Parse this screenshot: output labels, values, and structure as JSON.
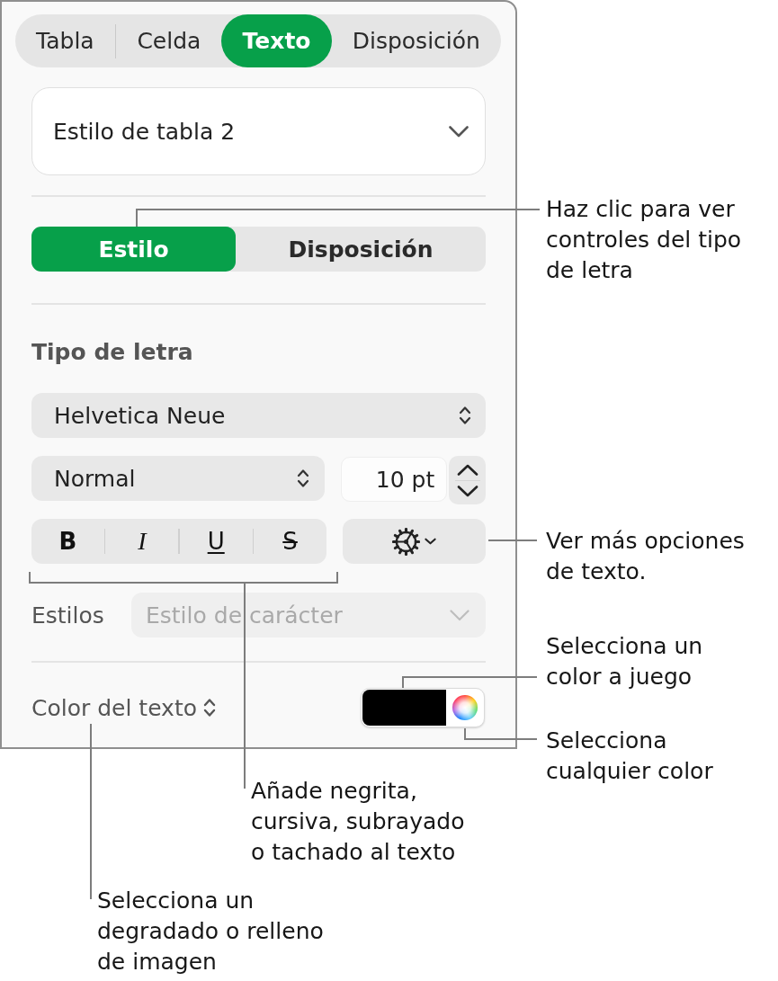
{
  "inspector_tabs": [
    {
      "label": "Tabla",
      "selected": false
    },
    {
      "label": "Celda",
      "selected": false
    },
    {
      "label": "Texto",
      "selected": true
    },
    {
      "label": "Disposición",
      "selected": false
    }
  ],
  "table_style": {
    "value": "Estilo de tabla 2"
  },
  "text_tabs": [
    {
      "label": "Estilo",
      "selected": true
    },
    {
      "label": "Disposición",
      "selected": false
    }
  ],
  "font": {
    "heading": "Tipo de letra",
    "family": "Helvetica Neue",
    "typeface": "Normal",
    "size": "10 pt"
  },
  "format_buttons": [
    {
      "label": "B",
      "kind": "bold"
    },
    {
      "label": "I",
      "kind": "italic"
    },
    {
      "label": "U",
      "kind": "underline"
    },
    {
      "label": "S",
      "kind": "strikethrough"
    }
  ],
  "character_styles": {
    "label": "Estilos",
    "value": "Estilo de carácter",
    "disabled": true
  },
  "text_color": {
    "label": "Color del texto",
    "color": "#000000"
  },
  "callouts": [
    {
      "text": "Haz clic para ver controles del tipo de letra"
    },
    {
      "text": "Ver más opciones de texto."
    },
    {
      "text": "Selecciona un color a juego"
    },
    {
      "text": "Selecciona cualquier color"
    },
    {
      "text": "Añade negrita, cursiva, subrayado o tachado al texto"
    },
    {
      "text": "Selecciona un degradado o relleno de imagen"
    }
  ]
}
